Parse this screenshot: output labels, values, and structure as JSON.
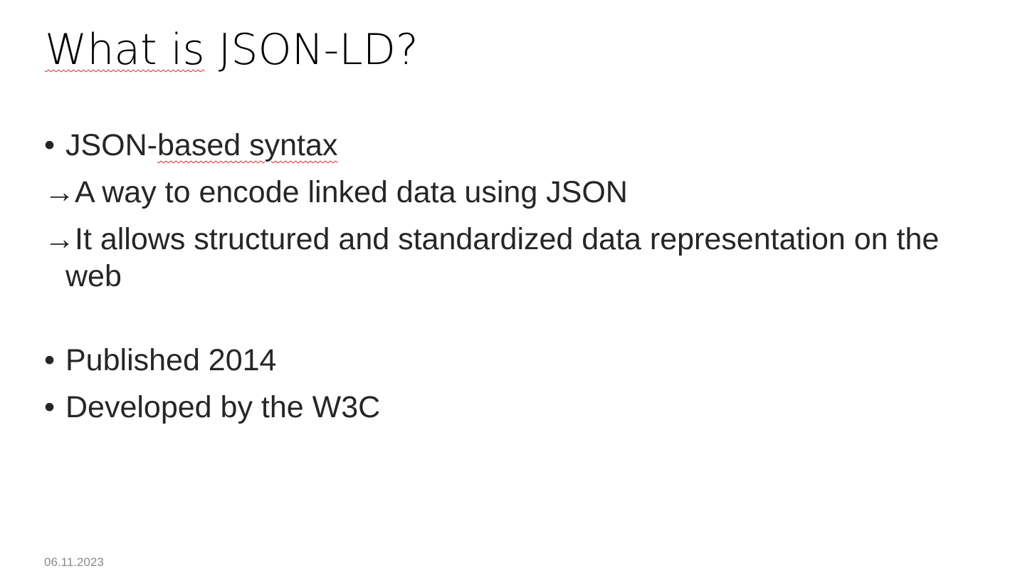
{
  "slide": {
    "title": {
      "part1": "What is",
      "part2": " JSON-LD?"
    },
    "bullet_glyph": "•",
    "arrow_glyph": "→",
    "items": [
      {
        "pre": "JSON-",
        "spell": "based syntax"
      },
      {
        "text": "A way to encode linked data using JSON"
      },
      {
        "text": "It allows structured and standardized data representation on the web"
      },
      {
        "text": "Published 2014"
      },
      {
        "text": "Developed by the W3C"
      }
    ],
    "date": "06.11.2023"
  },
  "colors": {
    "title": "#000000",
    "body": "#262626",
    "footer": "#8a8a8a",
    "spellcheck": "#e02020"
  }
}
